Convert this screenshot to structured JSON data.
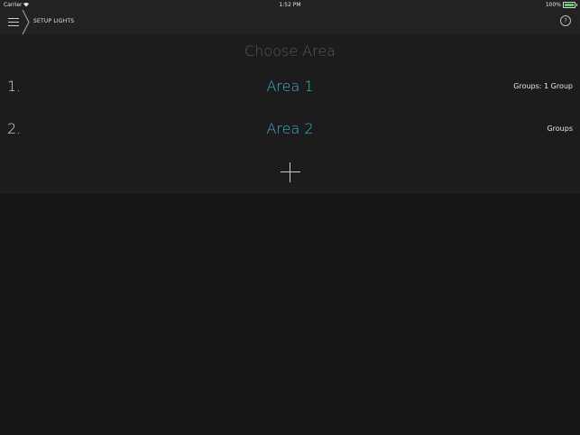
{
  "status_bar": {
    "carrier": "Carrier",
    "time": "1:52 PM",
    "battery_percent": "100%",
    "battery_level": 1.0,
    "wifi_icon": "wifi-icon",
    "battery_icon": "battery-icon"
  },
  "nav": {
    "title": "SETUP LIGHTS",
    "menu_icon": "hamburger-menu-icon",
    "help_icon": "help-icon",
    "help_glyph": "?"
  },
  "main": {
    "heading": "Choose Area",
    "areas": [
      {
        "number": "1.",
        "name": "Area 1",
        "groups": "Groups: 1 Group"
      },
      {
        "number": "2.",
        "name": "Area 2",
        "groups": "Groups"
      }
    ],
    "add_icon": "plus-icon"
  },
  "colors": {
    "accent": "#3fb3ce",
    "background": "#151515",
    "bar": "#222222",
    "battery": "#4cd964"
  }
}
